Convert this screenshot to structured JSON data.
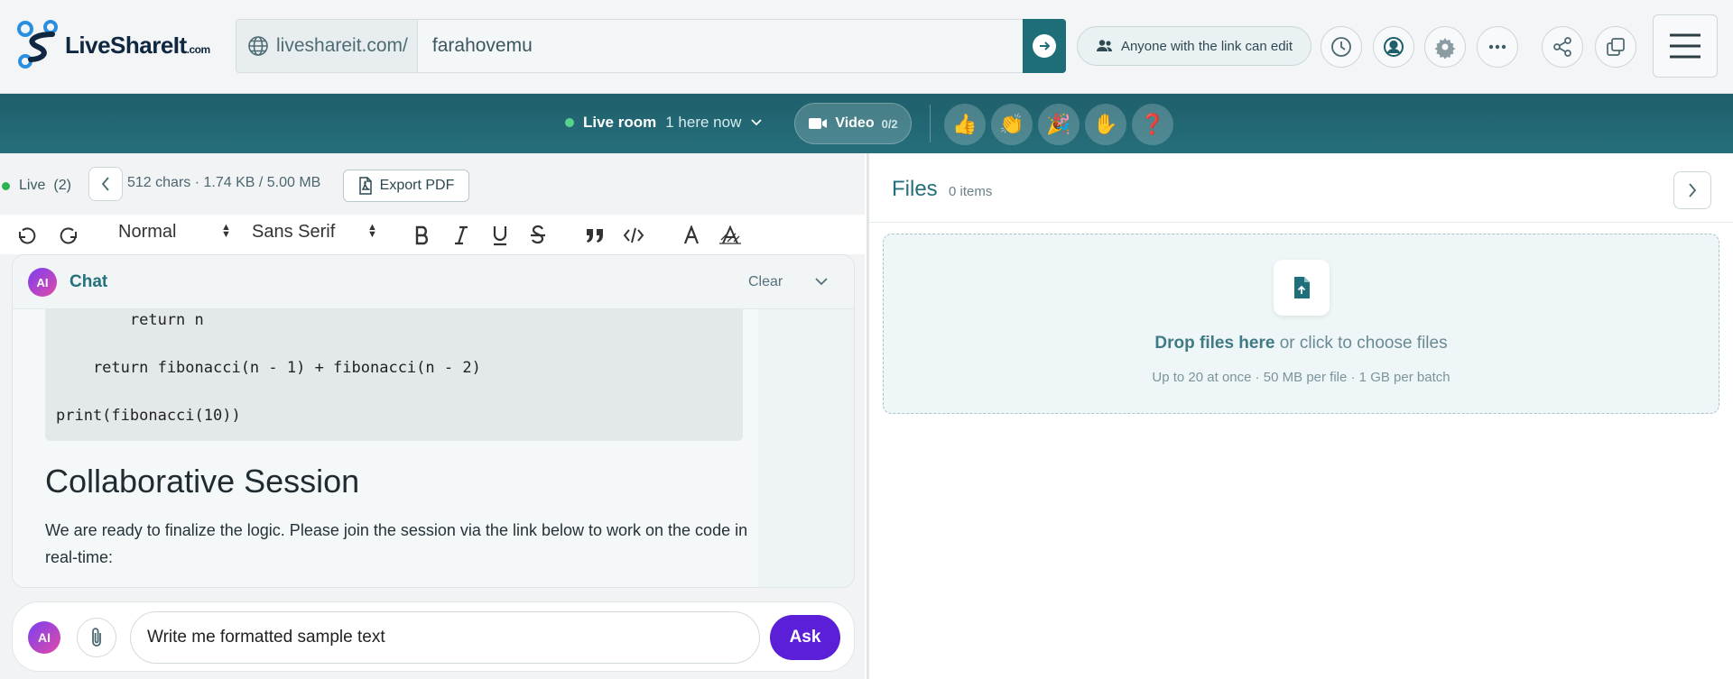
{
  "header": {
    "logo_text": "LiveShareIt",
    "logo_suffix": ".com",
    "url_prefix": "liveshareit.com/",
    "url_slug": "farahovemu",
    "permission_label": "Anyone with the link can edit",
    "icons": [
      "history-icon",
      "account-icon",
      "settings-icon",
      "more-icon",
      "share-icon",
      "copy-icon",
      "menu-icon"
    ]
  },
  "livebar": {
    "room_label": "Live room",
    "here_now": "1 here now",
    "video_label": "Video",
    "video_count": "0/2",
    "reactions": [
      "👍",
      "👏",
      "🎉",
      "✋",
      "❓"
    ]
  },
  "editor": {
    "live_label": "Live",
    "live_count": "(2)",
    "char_info": "512 chars · 1.74 KB / 5.00 MB",
    "export_label": "Export PDF",
    "toolbar": {
      "format_value": "Normal",
      "font_value": "Sans Serif"
    }
  },
  "chat": {
    "badge": "AI",
    "title": "Chat",
    "clear_label": "Clear",
    "code_lines": [
      "        return n",
      "    return fibonacci(n - 1) + fibonacci(n - 2)",
      "print(fibonacci(10))"
    ],
    "heading": "Collaborative Session",
    "paragraph": "We are ready to finalize the logic. Please join the session via the link below to work on the code in real-time:",
    "input_value": "Write me formatted sample text",
    "ask_label": "Ask"
  },
  "files": {
    "title": "Files",
    "count": "0 items",
    "drop_bold": "Drop files here",
    "drop_rest": " or click to choose files",
    "drop_sub": "Up to 20 at once · 50 MB per file · 1 GB per batch"
  },
  "colors": {
    "accent": "#1d6e78",
    "ask_button": "#5a1fd6",
    "live_dot": "#2fb34f"
  }
}
